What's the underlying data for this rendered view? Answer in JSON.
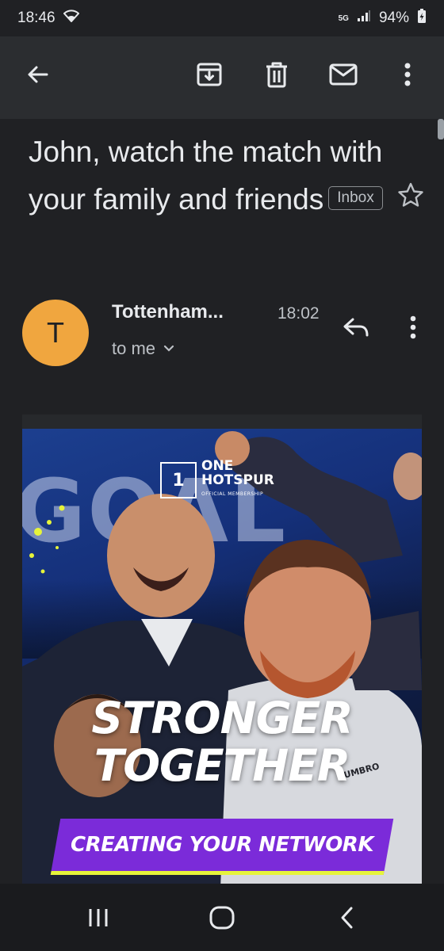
{
  "status": {
    "time": "18:46",
    "network": "5G",
    "battery": "94%"
  },
  "appbar": {
    "back_icon": "arrow-back-icon",
    "archive_icon": "archive-icon",
    "delete_icon": "trash-icon",
    "unread_icon": "mail-icon",
    "more_icon": "more-vert-icon"
  },
  "email": {
    "subject": "John, watch the match with your family and friends",
    "label": "Inbox",
    "sender_initial": "T",
    "sender": "Tottenham...",
    "time": "18:02",
    "recipient": "to me"
  },
  "hero": {
    "logo_line1": "ONE",
    "logo_line2": "HOTSPUR",
    "logo_line3": "OFFICIAL MEMBERSHIP",
    "background_text": "GOAL",
    "headline_line1": "STRONGER",
    "headline_line2": "TOGETHER",
    "banner": "CREATING YOUR NETWORK",
    "kit_brand": "UMBRO"
  },
  "colors": {
    "background": "#202124",
    "appbar": "#2b2d30",
    "avatar": "#f0a63f",
    "banner": "#7b2bd9",
    "accent_yellow": "#e6f43a"
  }
}
